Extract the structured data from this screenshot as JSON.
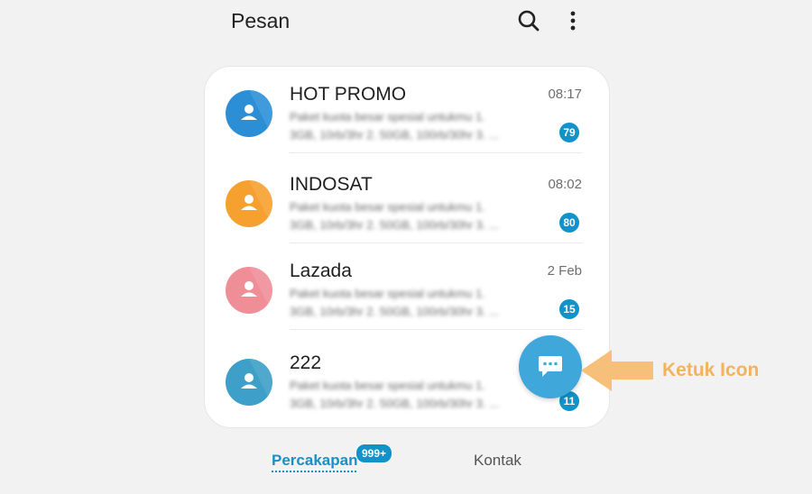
{
  "header": {
    "title": "Pesan",
    "search_icon": "search-icon",
    "more_icon": "more-vertical-icon"
  },
  "conversations": [
    {
      "name": "HOT PROMO",
      "time": "08:17",
      "preview_line1": "Paket kuota besar spesial untukmu 1.",
      "preview_line2": "3GB, 10rb/3hr 2. 50GB, 100rb/30hr 3. ...",
      "unread": "79",
      "avatar_color": "#2c8fd6"
    },
    {
      "name": "INDOSAT",
      "time": "08:02",
      "preview_line1": "Paket kuota besar spesial untukmu 1.",
      "preview_line2": "3GB, 10rb/3hr 2. 50GB, 100rb/30hr 3. ...",
      "unread": "80",
      "avatar_color": "#f6a02f"
    },
    {
      "name": "Lazada",
      "time": "2 Feb",
      "preview_line1": "Paket kuota besar spesial untukmu 1.",
      "preview_line2": "3GB, 10rb/3hr 2. 50GB, 100rb/30hr 3. ...",
      "unread": "15",
      "avatar_color": "#f08e98"
    },
    {
      "name": "222",
      "time": "",
      "preview_line1": "Paket kuota besar spesial untukmu 1.",
      "preview_line2": "3GB, 10rb/3hr 2. 50GB, 100rb/30hr 3. ...",
      "unread": "11",
      "avatar_color": "#3e9fc8"
    }
  ],
  "fab": {
    "icon": "chat-bubble-icon",
    "color": "#3fa7d9"
  },
  "annotation": {
    "text": "Ketuk Icon",
    "color": "#f4b35a"
  },
  "tabs": {
    "conversations_label": "Percakapan",
    "conversations_badge": "999+",
    "contacts_label": "Kontak"
  },
  "colors": {
    "accent": "#1a8fc7",
    "badge": "#1391c9"
  }
}
